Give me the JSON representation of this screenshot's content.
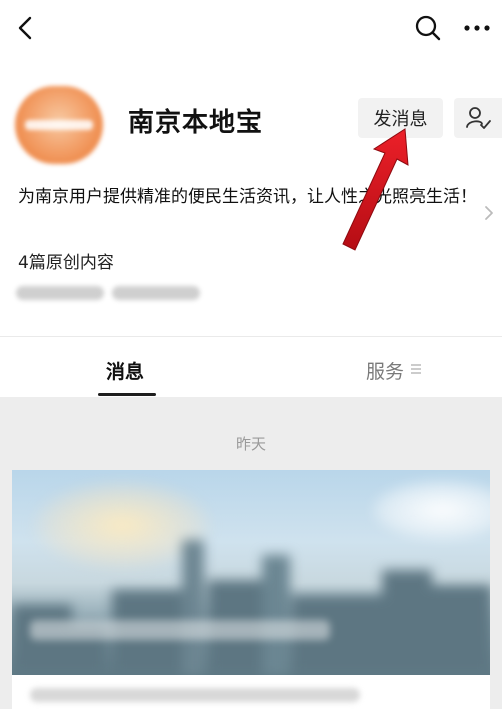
{
  "header": {
    "back_icon": "chevron-left-icon",
    "search_icon": "search-icon",
    "more_icon": "more-icon"
  },
  "profile": {
    "name": "南京本地宝",
    "message_button": "发消息",
    "follow_icon": "user-check-icon",
    "description": "为南京用户提供精准的便民生活资讯，让人性之光照亮生活！",
    "original_count": "4篇原创内容"
  },
  "tabs": {
    "messages": "消息",
    "services": "服务",
    "active": "消息"
  },
  "feed": {
    "date_label": "昨天"
  },
  "colors": {
    "annotation_arrow": "#e0141e",
    "feed_background": "#ededed",
    "button_background": "#f2f2f2"
  }
}
